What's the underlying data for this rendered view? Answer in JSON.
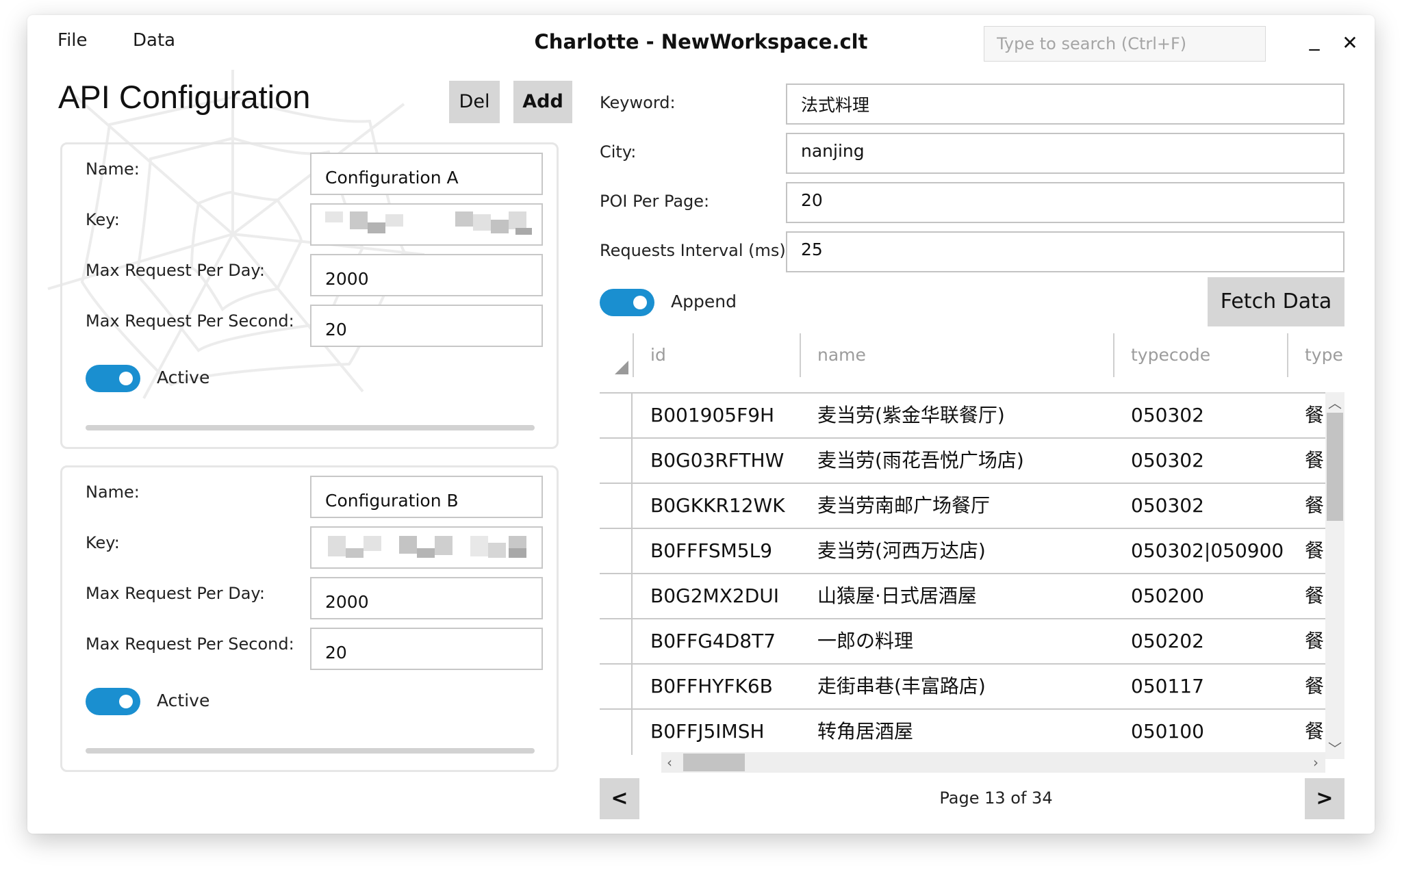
{
  "menu": {
    "file": "File",
    "data": "Data"
  },
  "window": {
    "title": "Charlotte - NewWorkspace.clt",
    "minimize": "_",
    "close": "✕"
  },
  "search": {
    "placeholder": "Type to search (Ctrl+F)"
  },
  "left": {
    "title": "API Configuration",
    "del_label": "Del",
    "add_label": "Add",
    "labels": {
      "name": "Name:",
      "key": "Key:",
      "max_day": "Max Request Per Day:",
      "max_second": "Max Request Per Second:",
      "active": "Active"
    },
    "configs": [
      {
        "name": "Configuration A",
        "max_day": "2000",
        "max_second": "20",
        "active": true
      },
      {
        "name": "Configuration B",
        "max_day": "2000",
        "max_second": "20",
        "active": true
      }
    ]
  },
  "right": {
    "keyword_label": "Keyword:",
    "keyword_value": "法式料理",
    "city_label": "City:",
    "city_value": "nanjing",
    "poi_label": "POI Per Page:",
    "poi_value": "20",
    "interval_label": "Requests Interval (ms):",
    "interval_value": "25",
    "append_label": "Append",
    "append_on": true,
    "fetch_label": "Fetch Data"
  },
  "table": {
    "columns": [
      "id",
      "name",
      "typecode",
      "type"
    ],
    "rows": [
      [
        "B001905F9H",
        "麦当劳(紫金华联餐厅)",
        "050302",
        "餐"
      ],
      [
        "B0G03RFTHW",
        "麦当劳(雨花吾悦广场店)",
        "050302",
        "餐"
      ],
      [
        "B0GKKR12WK",
        "麦当劳南邮广场餐厅",
        "050302",
        "餐"
      ],
      [
        "B0FFFSM5L9",
        "麦当劳(河西万达店)",
        "050302|050900",
        "餐"
      ],
      [
        "B0G2MX2DUI",
        "山猿屋·日式居酒屋",
        "050200",
        "餐"
      ],
      [
        "B0FFG4D8T7",
        "一郎の料理",
        "050202",
        "餐"
      ],
      [
        "B0FFHYFK6B",
        "走街串巷(丰富路店)",
        "050117",
        "餐"
      ],
      [
        "B0FFJ5IMSH",
        "转角居酒屋",
        "050100",
        "餐"
      ]
    ]
  },
  "pager": {
    "prev": "<",
    "next": ">",
    "text": "Page 13 of 34"
  },
  "colors": {
    "accent": "#1a8fd0",
    "button_gray": "#d6d6d6"
  }
}
